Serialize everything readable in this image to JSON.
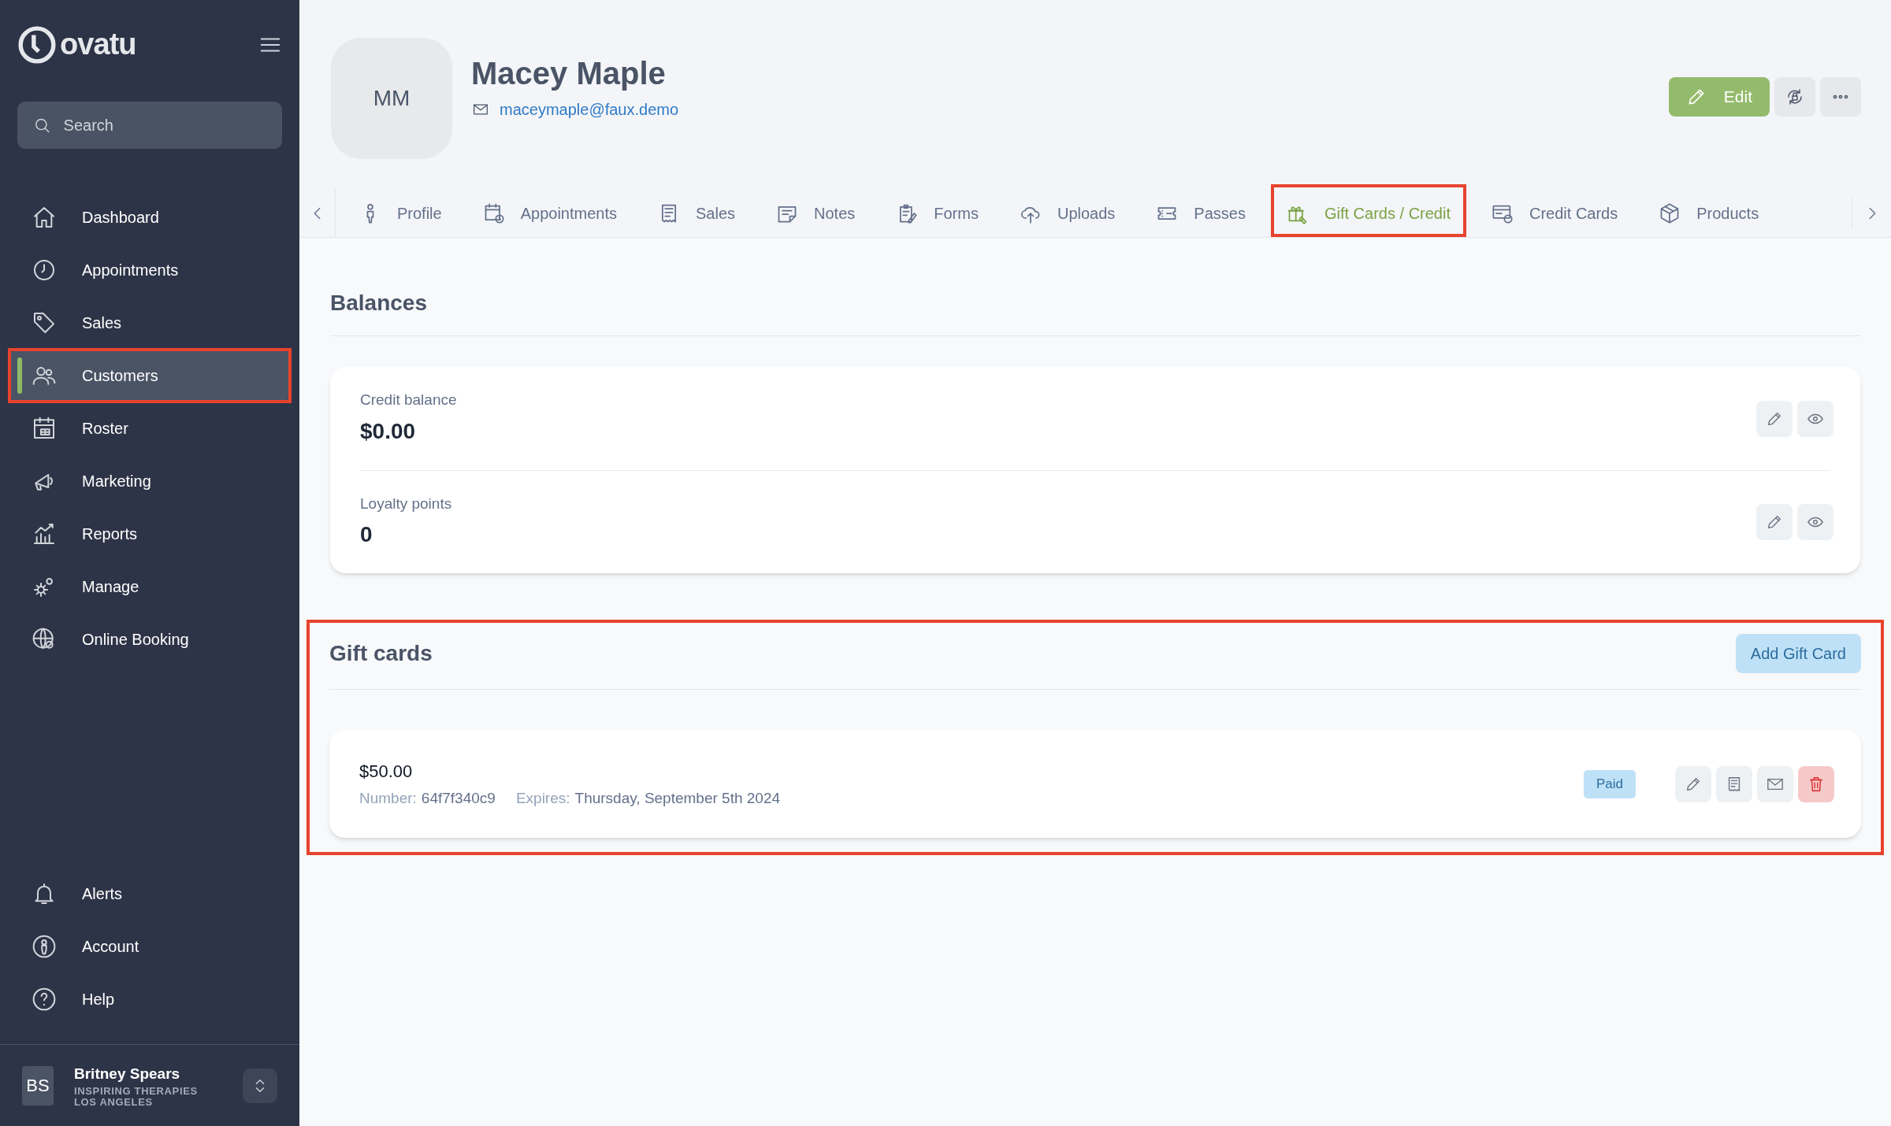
{
  "sidebar": {
    "logo": "ovatu",
    "search": {
      "placeholder": "Search"
    },
    "nav": [
      {
        "label": "Dashboard",
        "selected": false,
        "highlighted": false
      },
      {
        "label": "Appointments",
        "selected": false,
        "highlighted": false
      },
      {
        "label": "Sales",
        "selected": false,
        "highlighted": false
      },
      {
        "label": "Customers",
        "selected": true,
        "highlighted": true
      },
      {
        "label": "Roster",
        "selected": false,
        "highlighted": false
      },
      {
        "label": "Marketing",
        "selected": false,
        "highlighted": false
      },
      {
        "label": "Reports",
        "selected": false,
        "highlighted": false
      },
      {
        "label": "Manage",
        "selected": false,
        "highlighted": false
      },
      {
        "label": "Online Booking",
        "selected": false,
        "highlighted": false
      }
    ],
    "bottom_nav": [
      {
        "label": "Alerts"
      },
      {
        "label": "Account"
      },
      {
        "label": "Help"
      }
    ],
    "user": {
      "initials": "BS",
      "name": "Britney Spears",
      "business": "INSPIRING THERAPIES LOS ANGELES"
    }
  },
  "customer": {
    "initials": "MM",
    "name": "Macey Maple",
    "email": "maceymaple@faux.demo",
    "edit_button": "Edit"
  },
  "tabs": [
    {
      "label": "Profile",
      "selected": false,
      "highlighted": false
    },
    {
      "label": "Appointments",
      "selected": false,
      "highlighted": false
    },
    {
      "label": "Sales",
      "selected": false,
      "highlighted": false
    },
    {
      "label": "Notes",
      "selected": false,
      "highlighted": false
    },
    {
      "label": "Forms",
      "selected": false,
      "highlighted": false
    },
    {
      "label": "Uploads",
      "selected": false,
      "highlighted": false
    },
    {
      "label": "Passes",
      "selected": false,
      "highlighted": false
    },
    {
      "label": "Gift Cards / Credit",
      "selected": true,
      "highlighted": true
    },
    {
      "label": "Credit Cards",
      "selected": false,
      "highlighted": false
    },
    {
      "label": "Products",
      "selected": false,
      "highlighted": false
    }
  ],
  "balances": {
    "title": "Balances",
    "rows": [
      {
        "label": "Credit balance",
        "value": "$0.00"
      },
      {
        "label": "Loyalty points",
        "value": "0"
      }
    ]
  },
  "gift_cards": {
    "title": "Gift cards",
    "highlighted": true,
    "add_button": "Add Gift Card",
    "items": [
      {
        "amount": "$50.00",
        "number_label": "Number:",
        "number": "64f7f340c9",
        "expires_label": "Expires:",
        "expires": "Thursday, September 5th 2024",
        "status": "Paid"
      }
    ]
  }
}
